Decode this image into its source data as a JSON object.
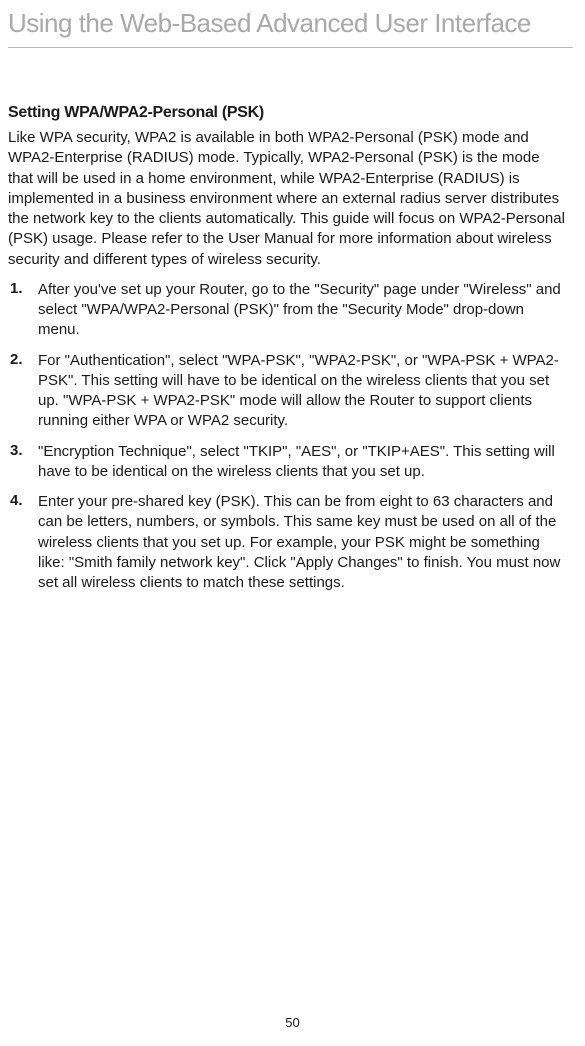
{
  "header": {
    "title": "Using the Web-Based Advanced User Interface"
  },
  "section": {
    "heading": "Setting WPA/WPA2-Personal (PSK)",
    "intro": "Like WPA security, WPA2 is available in both WPA2-Personal (PSK) mode and WPA2-Enterprise (RADIUS) mode. Typically, WPA2-Personal (PSK) is the mode that will be used in a home environment, while WPA2-Enterprise (RADIUS) is implemented in a business environment where an external radius server distributes the network key to the clients automatically. This guide will focus on WPA2-Personal (PSK) usage. Please refer to the User Manual for more information about wireless security and different types of wireless security.",
    "steps": [
      {
        "number": "1.",
        "text": "After you've set up your Router, go to the \"Security\" page under \"Wireless\" and select \"WPA/WPA2-Personal (PSK)\" from the \"Security Mode\" drop-down menu."
      },
      {
        "number": "2.",
        "text": "For \"Authentication\", select \"WPA-PSK\", \"WPA2-PSK\", or \"WPA-PSK + WPA2-PSK\". This setting will have to be identical on the wireless clients that you set up. \"WPA-PSK + WPA2-PSK\" mode will allow the Router to support clients running either WPA or WPA2 security."
      },
      {
        "number": "3.",
        "text": "\"Encryption Technique\", select \"TKIP\",  \"AES\", or \"TKIP+AES\". This setting will have to be identical on the wireless clients that you set up."
      },
      {
        "number": "4.",
        "text": "Enter your pre-shared key (PSK). This can be from eight to 63 characters and can be letters, numbers, or symbols. This same key must be used on all of the wireless clients that you set up. For example, your PSK might be something like: \"Smith family network key\". Click \"Apply Changes\" to finish. You must now set all wireless clients to match these settings."
      }
    ]
  },
  "footer": {
    "page_number": "50"
  }
}
